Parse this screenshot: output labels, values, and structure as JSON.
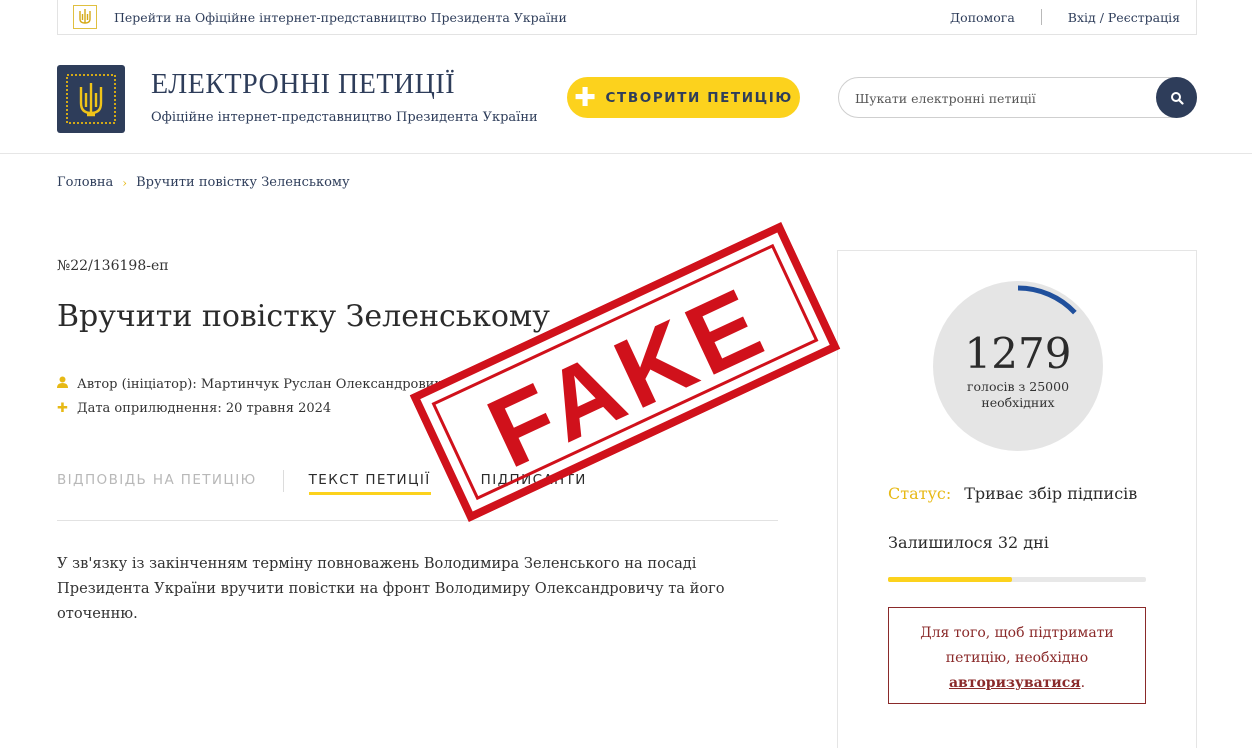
{
  "topbar": {
    "president_link": "Перейти на Офіційне інтернет-представництво Президента України",
    "help": "Допомога",
    "login": "Вхід / Реєстрація"
  },
  "header": {
    "title": "ЕЛЕКТРОННІ ПЕТИЦІЇ",
    "subtitle": "Офіційне інтернет-представництво Президента України",
    "create_button": "СТВОРИТИ ПЕТИЦІЮ",
    "search_placeholder": "Шукати електронні петиції"
  },
  "breadcrumb": {
    "home": "Головна",
    "current": "Вручити повістку Зеленському"
  },
  "petition": {
    "number": "№22/136198-еп",
    "title": "Вручити повістку Зеленському",
    "author": "Автор (ініціатор): Мартинчук Руслан Олександрович",
    "date": "Дата оприлюднення: 20 травня 2024",
    "tabs": {
      "answer": "ВІДПОВІДЬ НА ПЕТИЦІЮ",
      "text": "ТЕКСТ ПЕТИЦІЇ",
      "signers": "ПІДПИСАНТИ"
    },
    "body": "У зв'язку із закінченням терміну повноважень Володимира Зеленського на посаді Президента України вручити повістки на фронт Володимиру Олександровичу та його оточенню."
  },
  "sidebar": {
    "votes": "1279",
    "votes_sub": "голосів з 25000 необхідних",
    "votes_value": 1279,
    "votes_target": 25000,
    "status_label": "Статус:",
    "status_value": "Триває збір підписів",
    "remaining": "Залишилося 32 дні",
    "progress_fraction": 0.48,
    "auth_text": "Для того, щоб підтримати петицію, необхідно",
    "auth_link": "авторизуватися",
    "auth_end": "."
  },
  "stamp": {
    "text": "FAKE"
  },
  "colors": {
    "navy": "#2e3d5a",
    "yellow": "#fcd21d",
    "gold_text": "#e7b915",
    "stamp_red": "#d0111b",
    "auth_red": "#8a2a2a",
    "ring_blue": "#1f4f9c"
  }
}
